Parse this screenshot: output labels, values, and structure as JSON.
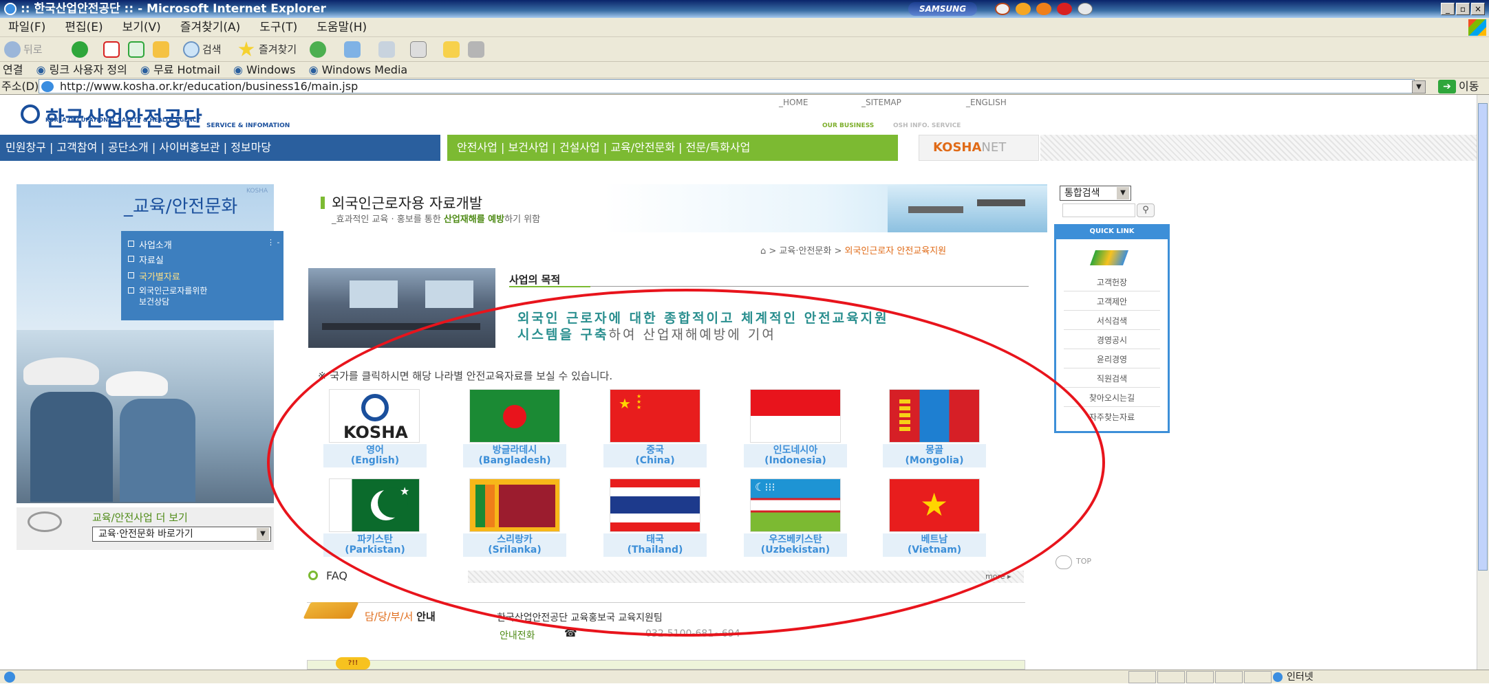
{
  "window": {
    "title": ":: 한국산업안전공단 :: - Microsoft Internet Explorer",
    "brand": "SAMSUNG",
    "buttons": [
      "_",
      "▫",
      "×"
    ]
  },
  "menu": [
    "파일(F)",
    "편집(E)",
    "보기(V)",
    "즐겨찾기(A)",
    "도구(T)",
    "도움말(H)"
  ],
  "toolbar": {
    "back": "뒤로",
    "search": "검색",
    "favorites": "즐겨찾기"
  },
  "links_bar": {
    "label": "연결",
    "items": [
      "링크 사용자 정의",
      "무료 Hotmail",
      "Windows",
      "Windows Media"
    ]
  },
  "address": {
    "label": "주소(D)",
    "url": "http://www.kosha.or.kr/education/business16/main.jsp",
    "go": "이동"
  },
  "site": {
    "logo": "한국산업안전공단",
    "logo_sub": "KOREA OCCUPATIONAL SAFETY & HEALTH AGENCY",
    "service_info": "SERVICE & INFOMATION",
    "top_links": [
      "_HOME",
      "_SITEMAP",
      "_ENGLISH"
    ],
    "our_business": "OUR BUSINESS",
    "osh_info": "OSH INFO. SERVICE",
    "nav_blue": "민원창구 | 고객참여 | 공단소개 | 사이버홍보관 | 정보마당",
    "nav_green": "안전사업 | 보건사업 | 건설사업 | 교육/안전문화 | 전문/특화사업",
    "kosha_net_a": "KOSHA",
    "kosha_net_b": "NET"
  },
  "left": {
    "kosha": "KOSHA",
    "title": "_교육/안전문화",
    "menu": [
      "사업소개",
      "자료실",
      "국가별자료",
      "외국인근로자를위한",
      "보건상담"
    ],
    "more_label": "교육/안전사업 더 보기",
    "more_select": "교육·안전문화 바로가기"
  },
  "main": {
    "title": "외국인근로자용 자료개발",
    "subtitle_pre": "_효과적인 교육 · 홍보를 통한 ",
    "subtitle_bold": "산업재해를 예방",
    "subtitle_post": "하기 위함",
    "breadcrumb": "> 교육·안전문화 > ",
    "breadcrumb_current": "외국인근로자 안전교육지원",
    "purpose": "사업의 목적",
    "sys_line1": "외국인 근로자에 대한 종합적이고 체계적인 안전교육지원",
    "sys_line2a": "시스템을 구축",
    "sys_line2b": "하여  산업재해예방에 기여",
    "notice": "※ 국가를 클릭하시면 해당 나라별 안전교육자료를 보실 수 있습니다.",
    "countries": [
      {
        "ko": "영어",
        "en": "(English)",
        "flag": "kosha"
      },
      {
        "ko": "방글라데시",
        "en": "(Bangladesh)",
        "flag": "bangladesh"
      },
      {
        "ko": "중국",
        "en": "(China)",
        "flag": "china"
      },
      {
        "ko": "인도네시아",
        "en": "(Indonesia)",
        "flag": "indonesia"
      },
      {
        "ko": "몽골",
        "en": "(Mongolia)",
        "flag": "mongolia"
      },
      {
        "ko": "파키스탄",
        "en": "(Parkistan)",
        "flag": "pakistan"
      },
      {
        "ko": "스리랑카",
        "en": "(Srilanka)",
        "flag": "srilanka"
      },
      {
        "ko": "태국",
        "en": "(Thailand)",
        "flag": "thailand"
      },
      {
        "ko": "우즈베키스탄",
        "en": "(Uzbekistan)",
        "flag": "uzbekistan"
      },
      {
        "ko": "베트남",
        "en": "(Vietnam)",
        "flag": "vietnam"
      }
    ],
    "kosha_flag_text": "KOSHA",
    "faq": "FAQ",
    "faq_more": "more ▸",
    "dept_label": "담/당/부/서",
    "dept_label2": "안내",
    "dept_name": "한국산업안전공단 교육홍보국 교육지원팀",
    "phone_label": "안내전화",
    "phone": "032-5100-681~694",
    "tag": "?!!"
  },
  "right": {
    "search_select": "통합검색",
    "quick_head": "QUICK LINK",
    "quick_links": [
      "고객헌장",
      "고객제안",
      "서식검색",
      "경영공시",
      "윤리경영",
      "직원검색",
      "찾아오시는길",
      "자주찾는자료"
    ],
    "top": "TOP"
  },
  "status": {
    "zone": "인터넷"
  }
}
